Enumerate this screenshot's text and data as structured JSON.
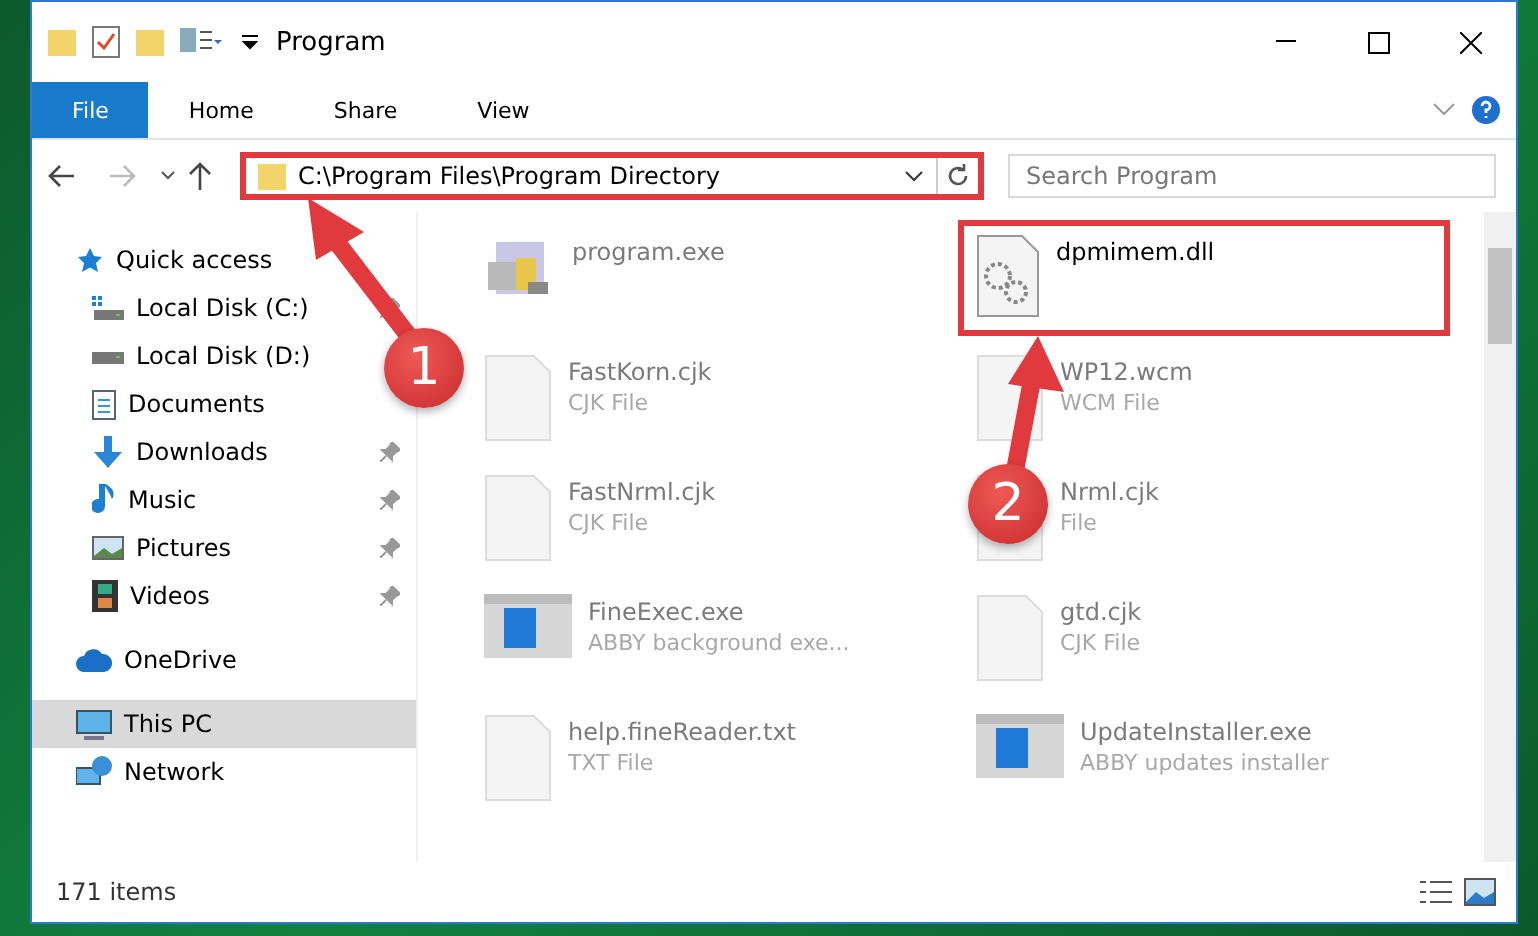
{
  "window": {
    "title": "Program"
  },
  "ribbon_tabs": [
    {
      "label": "File",
      "selected": true
    },
    {
      "label": "Home",
      "selected": false
    },
    {
      "label": "Share",
      "selected": false
    },
    {
      "label": "View",
      "selected": false
    }
  ],
  "address": {
    "path": "C:\\Program Files\\Program Directory",
    "highlighted": true
  },
  "search": {
    "placeholder": "Search Program"
  },
  "sidebar": {
    "items": [
      {
        "label": "Quick access",
        "selected": false,
        "children": [
          {
            "label": "Local Disk (C:)",
            "pinned": true,
            "selected": false
          },
          {
            "label": "Local Disk (D:)",
            "selected": false
          },
          {
            "label": "Documents",
            "selected": false
          },
          {
            "label": "Downloads",
            "pinned": true,
            "selected": false
          },
          {
            "label": "Music",
            "pinned": true,
            "selected": false
          },
          {
            "label": "Pictures",
            "pinned": true,
            "selected": false
          },
          {
            "label": "Videos",
            "pinned": true,
            "selected": false
          }
        ]
      },
      {
        "label": "OneDrive",
        "selected": false
      },
      {
        "label": "This PC",
        "selected": true
      },
      {
        "label": "Network",
        "selected": false
      }
    ]
  },
  "files": [
    {
      "name": "program.exe",
      "highlighted": false
    },
    {
      "name": "dpmimem.dll",
      "highlighted": true
    },
    {
      "name": "FastKorn.cjk",
      "type": "CJK File",
      "highlighted": false
    },
    {
      "name": "WP12.wcm",
      "type": "WCM File",
      "highlighted": false
    },
    {
      "name": "FastNrml.cjk",
      "type": "CJK File",
      "highlighted": false
    },
    {
      "name": "Nrml.cjk",
      "type": "File",
      "highlighted": false
    },
    {
      "name": "FineExec.exe",
      "type": "ABBY background exe...",
      "highlighted": false
    },
    {
      "name": "gtd.cjk",
      "type": "CJK File",
      "highlighted": false
    },
    {
      "name": "help.fineReader.txt",
      "type": "TXT File",
      "highlighted": false
    },
    {
      "name": "UpdateInstaller.exe",
      "type": "ABBY updates installer",
      "highlighted": false
    }
  ],
  "status_bar": {
    "count": "171 items"
  },
  "annotations": [
    {
      "label": "1"
    },
    {
      "label": "2"
    }
  ]
}
